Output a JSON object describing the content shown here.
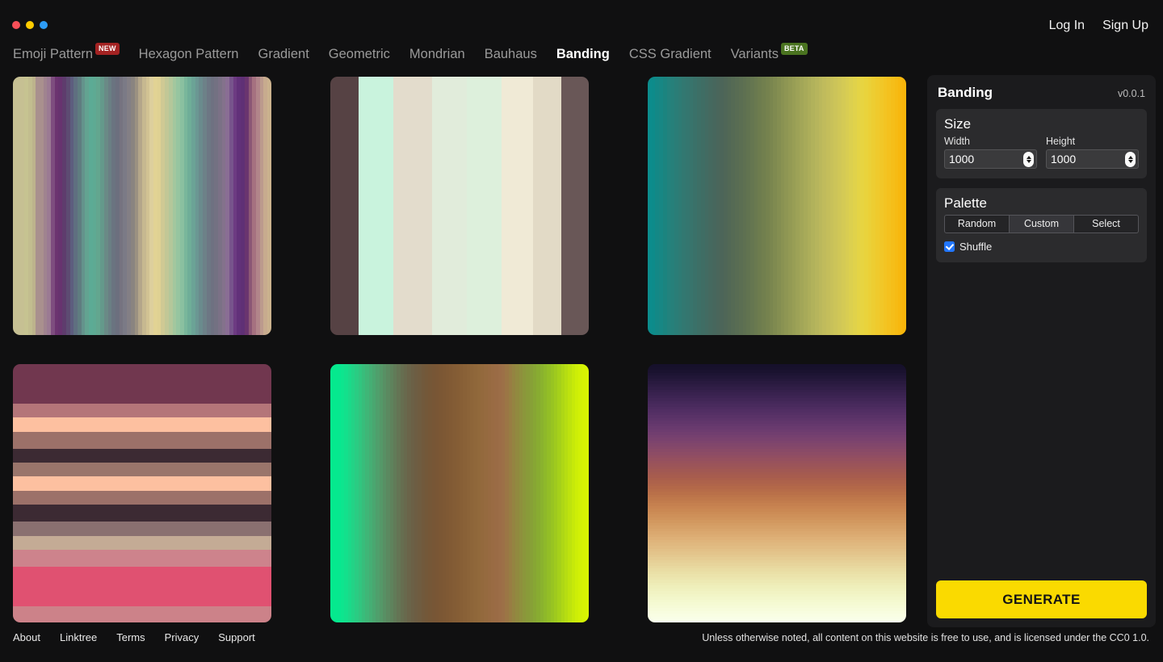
{
  "window": {
    "dots": [
      {
        "name": "close-dot",
        "color": "#f84f58"
      },
      {
        "name": "minimize-dot",
        "color": "#ffcc00"
      },
      {
        "name": "maximize-dot",
        "color": "#2d9cf5"
      }
    ]
  },
  "auth": {
    "login_label": "Log In",
    "signup_label": "Sign Up"
  },
  "nav": {
    "items": [
      {
        "label": "Emoji Pattern",
        "badge": "NEW",
        "badge_color": "#a32222",
        "active": false
      },
      {
        "label": "Hexagon Pattern",
        "badge": "",
        "active": false
      },
      {
        "label": "Gradient",
        "badge": "",
        "active": false
      },
      {
        "label": "Geometric",
        "badge": "",
        "active": false
      },
      {
        "label": "Mondrian",
        "badge": "",
        "active": false
      },
      {
        "label": "Bauhaus",
        "badge": "",
        "active": false
      },
      {
        "label": "Banding",
        "badge": "",
        "active": true
      },
      {
        "label": "CSS Gradient",
        "badge": "",
        "active": false
      },
      {
        "label": "Variants",
        "badge": "BETA",
        "badge_color": "#4a7320",
        "active": false
      }
    ]
  },
  "sidebar": {
    "title": "Banding",
    "version": "v0.0.1",
    "size": {
      "title": "Size",
      "width_label": "Width",
      "width_value": "1000",
      "height_label": "Height",
      "height_value": "1000"
    },
    "palette": {
      "title": "Palette",
      "buttons": [
        {
          "label": "Random",
          "selected": false
        },
        {
          "label": "Custom",
          "selected": true
        },
        {
          "label": "Select",
          "selected": false
        }
      ],
      "shuffle_label": "Shuffle",
      "shuffle_checked": true
    },
    "generate_label": "GENERATE",
    "generate_color": "#fada00"
  },
  "footer": {
    "links": [
      "About",
      "Linktree",
      "Terms",
      "Privacy",
      "Support"
    ],
    "note": "Unless otherwise noted, all content on this website is free to use, and is licensed under the CC0 1.0."
  },
  "cards": [
    {
      "name": "banding-card-1",
      "direction": "vert",
      "colors": [
        "#c6c093",
        "#c6c093",
        "#c6c093",
        "#c6c391",
        "#c2bd8f",
        "#bdb38c",
        "#a9908e",
        "#a9908e",
        "#a0838f",
        "#9b7a93",
        "#7e4d7f",
        "#6c3470",
        "#67336f",
        "#5e3c6d",
        "#5d4b72",
        "#5d5d7e",
        "#5f6f80",
        "#5f7d80",
        "#64938c",
        "#63a391",
        "#5cab95",
        "#5eaa93",
        "#63a68f",
        "#64998b",
        "#6a8a86",
        "#6a7f84",
        "#6a7480",
        "#6c6f7e",
        "#767380",
        "#7b7a86",
        "#837f85",
        "#8a8480",
        "#9b9181",
        "#b4a68a",
        "#c6b890",
        "#d1c293",
        "#ddcf9d",
        "#e2d394",
        "#dfd193",
        "#cfc994",
        "#c2c796",
        "#b4c79a",
        "#a3c79e",
        "#96c5a0",
        "#8ac0a0",
        "#79b79b",
        "#6fae98",
        "#6ba396",
        "#6b9793",
        "#6a8b8d",
        "#6d8188",
        "#6d7784",
        "#6e7181",
        "#737182",
        "#7b7186",
        "#84728c",
        "#8a6e94",
        "#77548c",
        "#6d3b82",
        "#62317a",
        "#5f3075",
        "#6a356f",
        "#8b5775",
        "#a57180",
        "#b1858a",
        "#bc9a8d",
        "#c7ab8e",
        "#cbb28e"
      ]
    },
    {
      "name": "banding-card-2",
      "direction": "vert",
      "colors": [
        "#564244",
        "#564244",
        "#564244",
        "#564244",
        "#564244",
        "#564244",
        "#564244",
        "#564244",
        "#c9f3dd",
        "#c9f3dd",
        "#c9f3dd",
        "#c9f3dd",
        "#c9f3dd",
        "#c9f3dd",
        "#c9f3dd",
        "#c9f3dd",
        "#c9f3dd",
        "#c9f3dd",
        "#e3dccc",
        "#e3dccc",
        "#e3dccc",
        "#e3dccc",
        "#e3dccc",
        "#e3dccc",
        "#e3dccc",
        "#e3dccc",
        "#e3dccc",
        "#e3dccc",
        "#e3dccc",
        "#e1ecdb",
        "#e1ecdb",
        "#e1ecdb",
        "#e1ecdb",
        "#e1ecdb",
        "#e1ecdb",
        "#e1ecdb",
        "#e1ecdb",
        "#e1ecdb",
        "#e1ecdb",
        "#ddf0dc",
        "#ddf0dc",
        "#ddf0dc",
        "#ddf0dc",
        "#ddf0dc",
        "#ddf0dc",
        "#ddf0dc",
        "#ddf0dc",
        "#ddf0dc",
        "#ddf0dc",
        "#f0ead6",
        "#f0ead6",
        "#f0ead6",
        "#f0ead6",
        "#f0ead6",
        "#f0ead6",
        "#f0ead6",
        "#f0ead6",
        "#f0ead6",
        "#e2dac6",
        "#e2dac6",
        "#e2dac6",
        "#e2dac6",
        "#e2dac6",
        "#e2dac6",
        "#e2dac6",
        "#e2dac6",
        "#695757",
        "#695757",
        "#695757",
        "#695757",
        "#695757",
        "#695757",
        "#695757",
        "#695757"
      ]
    },
    {
      "name": "banding-card-3",
      "direction": "vert",
      "colors": [
        "#0c8c8c",
        "#0d8b8a",
        "#138886",
        "#178784",
        "#1b847f",
        "#22827d",
        "#26807a",
        "#2a7d77",
        "#2e7b74",
        "#327871",
        "#34766f",
        "#38746c",
        "#3a7169",
        "#3d6f66",
        "#3f6d64",
        "#426b62",
        "#45695f",
        "#47675d",
        "#4a665b",
        "#4c6559",
        "#4f6657",
        "#526855",
        "#556a54",
        "#586c53",
        "#5b6e52",
        "#5e7051",
        "#617350",
        "#657650",
        "#69794f",
        "#6d7c4e",
        "#717f4e",
        "#75824e",
        "#7a864f",
        "#7f8a50",
        "#848e51",
        "#899252",
        "#8e9653",
        "#939a54",
        "#989e55",
        "#9da257",
        "#a2a658",
        "#a7aa59",
        "#acae5a",
        "#b1b25b",
        "#b6b55c",
        "#bbb85c",
        "#c0bb5c",
        "#c4be5b",
        "#c8c15a",
        "#ccc459",
        "#d0c757",
        "#d4ca55",
        "#d8cd52",
        "#dcd04f",
        "#e0d24b",
        "#e4d446",
        "#e7d441",
        "#e9d33c",
        "#ebd037",
        "#edcd32",
        "#efca2d",
        "#f1c728",
        "#f3c423",
        "#f4c11e",
        "#f5be19",
        "#f6bb14",
        "#f7b80f",
        "#f8b50a"
      ]
    },
    {
      "name": "banding-card-4",
      "direction": "horz",
      "colors": [
        "#71374f",
        "#71374f",
        "#71374f",
        "#71374f",
        "#71374f",
        "#71374f",
        "#71374f",
        "#71374f",
        "#71374f",
        "#71374f",
        "#71374f",
        "#71374f",
        "#71374f",
        "#71374f",
        "#b47579",
        "#b47579",
        "#b47579",
        "#b47579",
        "#b47579",
        "#fdc0a0",
        "#fdc0a0",
        "#fdc0a0",
        "#fdc0a0",
        "#fdc0a0",
        "#9c7169",
        "#9c7169",
        "#9c7169",
        "#9c7169",
        "#9c7169",
        "#9c7169",
        "#3c2a33",
        "#3c2a33",
        "#3c2a33",
        "#3c2a33",
        "#3c2a33",
        "#9a756b",
        "#9a756b",
        "#9a756b",
        "#9a756b",
        "#9a756b",
        "#fdc0a0",
        "#fdc0a0",
        "#fdc0a0",
        "#fdc0a0",
        "#fdc0a0",
        "#9c7169",
        "#9c7169",
        "#9c7169",
        "#9c7169",
        "#9c7169",
        "#3c2a33",
        "#3c2a33",
        "#3c2a33",
        "#3c2a33",
        "#3c2a33",
        "#3c2a33",
        "#8a7070",
        "#8a7070",
        "#8a7070",
        "#8a7070",
        "#8a7070",
        "#c4ab95",
        "#c4ab95",
        "#c4ab95",
        "#c4ab95",
        "#c4ab95",
        "#cd838c",
        "#cd838c",
        "#cd838c",
        "#cd838c",
        "#cd838c",
        "#cd838c",
        "#e05171",
        "#e05171",
        "#e05171",
        "#e05171",
        "#e05171",
        "#e05171",
        "#e05171",
        "#e05171",
        "#e05171",
        "#e05171",
        "#e05171",
        "#e05171",
        "#e05171",
        "#e05171",
        "#cc8289",
        "#cc8289",
        "#cc8289",
        "#cc8289",
        "#cc8289",
        "#cc8289"
      ]
    },
    {
      "name": "banding-card-5",
      "direction": "vert",
      "colors": [
        "#05e98e",
        "#05e98e",
        "#07e78f",
        "#0de58e",
        "#13e08c",
        "#1bd989",
        "#22d386",
        "#2acc83",
        "#31c57f",
        "#38bd7b",
        "#3fb677",
        "#45ae74",
        "#4aa770",
        "#4f9f6c",
        "#549868",
        "#589064",
        "#5b8960",
        "#5e825c",
        "#617b58",
        "#647454",
        "#666e50",
        "#68694d",
        "#6a6449",
        "#6b6046",
        "#6d5d43",
        "#6f5c40",
        "#71593c",
        "#735839",
        "#755737",
        "#775636",
        "#795635",
        "#7b5734",
        "#7d5834",
        "#7f5934",
        "#815a34",
        "#835c35",
        "#855d35",
        "#875f36",
        "#896137",
        "#8b6338",
        "#8d6539",
        "#8f673a",
        "#91693b",
        "#93693d",
        "#956a3f",
        "#976a41",
        "#996b43",
        "#9a6b45",
        "#9c6d47",
        "#9c7047",
        "#9b7645",
        "#987d43",
        "#948441",
        "#918a3f",
        "#8e903d",
        "#8b963b",
        "#899b39",
        "#87a037",
        "#87a634",
        "#88ac31",
        "#8ab22e",
        "#8eb82a",
        "#93be26",
        "#98c422",
        "#9fca1e",
        "#a6d11a",
        "#aed716",
        "#b6dd12",
        "#bee30e",
        "#c6e90a",
        "#cdee07",
        "#d2f105",
        "#d6f303",
        "#d8f402"
      ]
    },
    {
      "name": "banding-card-6",
      "direction": "horz",
      "colors": [
        "#16102b",
        "#17112c",
        "#1a122f",
        "#1d1433",
        "#211637",
        "#25183b",
        "#291a3f",
        "#2d1c43",
        "#311e47",
        "#35204b",
        "#39224f",
        "#3d2453",
        "#412656",
        "#45285a",
        "#492a5d",
        "#4d2c60",
        "#512e63",
        "#553065",
        "#593267",
        "#5d3469",
        "#61366b",
        "#65386d",
        "#693a6e",
        "#6d3c6f",
        "#713e6f",
        "#75406f",
        "#79426e",
        "#7d446d",
        "#81466b",
        "#854869",
        "#894a67",
        "#8d4c65",
        "#914e62",
        "#95505f",
        "#98525c",
        "#9b5459",
        "#9e5656",
        "#a15853",
        "#a45a50",
        "#a75c4e",
        "#aa5f4c",
        "#ad624b",
        "#b0654a",
        "#b36849",
        "#b66c49",
        "#b97049",
        "#bc744a",
        "#bf784b",
        "#c27c4d",
        "#c5804f",
        "#c88451",
        "#ca8853",
        "#cc8c56",
        "#ce9059",
        "#d0945c",
        "#d2985f",
        "#d49c63",
        "#d6a067",
        "#d8a46b",
        "#daa86f",
        "#dcac73",
        "#deb077",
        "#dfb47b",
        "#e0b87f",
        "#e1bc83",
        "#e2c087",
        "#e3c48b",
        "#e4c88f",
        "#e5cc93",
        "#e6d097",
        "#e7d49b",
        "#e8d89f",
        "#e9dca3",
        "#eae0a7",
        "#ebe3ab",
        "#ece6af",
        "#ede9b3",
        "#eeecb7",
        "#efefbb",
        "#f0f1bf",
        "#f1f3c3",
        "#f2f5c7",
        "#f3f7cb",
        "#f4f9cf",
        "#f5fad3",
        "#f6fbd7",
        "#f7fcdb",
        "#f8fddf",
        "#f9fee3",
        "#f9fee7",
        "#faffeb"
      ]
    }
  ]
}
